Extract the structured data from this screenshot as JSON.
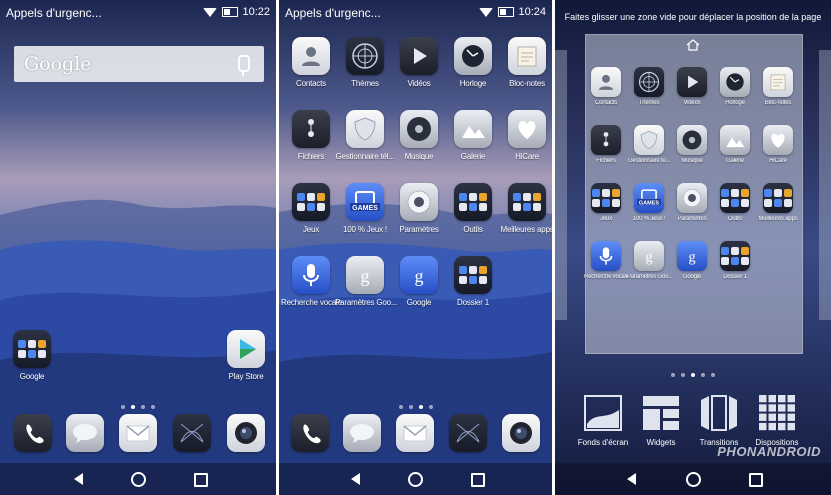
{
  "panels": [
    {
      "status": {
        "carrier": "Appels d'urgenc...",
        "time": "10:22"
      },
      "search": {
        "logo": "Google"
      },
      "apps": [
        {
          "label": "Google",
          "icon": "folder-icon"
        },
        {
          "label": "Play Store",
          "icon": "play-store-icon"
        }
      ],
      "page_indicator": {
        "count": 4,
        "active": 1
      },
      "dock": [
        "phone-icon",
        "messages-icon",
        "email-icon",
        "browser-icon",
        "camera-icon"
      ]
    },
    {
      "status": {
        "carrier": "Appels d'urgenc...",
        "time": "10:24"
      },
      "apps": [
        {
          "label": "Contacts",
          "icon": "contacts-icon"
        },
        {
          "label": "Thèmes",
          "icon": "themes-icon"
        },
        {
          "label": "Vidéos",
          "icon": "videos-icon"
        },
        {
          "label": "Horloge",
          "icon": "clock-icon"
        },
        {
          "label": "Bloc-notes",
          "icon": "notepad-icon"
        },
        {
          "label": "Fichiers",
          "icon": "files-icon"
        },
        {
          "label": "Gestionnaire tél...",
          "icon": "phone-manager-icon"
        },
        {
          "label": "Musique",
          "icon": "music-icon"
        },
        {
          "label": "Galerie",
          "icon": "gallery-icon"
        },
        {
          "label": "HiCare",
          "icon": "hicare-icon"
        },
        {
          "label": "Jeux",
          "icon": "folder-icon"
        },
        {
          "label": "100 % Jeux !",
          "icon": "games-icon"
        },
        {
          "label": "Paramètres",
          "icon": "settings-icon"
        },
        {
          "label": "Outils",
          "icon": "folder-icon"
        },
        {
          "label": "Meilleures apps",
          "icon": "folder-icon"
        },
        {
          "label": "Recherche vocale",
          "icon": "voice-search-icon"
        },
        {
          "label": "Paramètres Goo...",
          "icon": "google-settings-icon"
        },
        {
          "label": "Google",
          "icon": "google-icon"
        },
        {
          "label": "Dossier 1",
          "icon": "folder-icon"
        }
      ],
      "games_badge": "GAMES",
      "page_indicator": {
        "count": 4,
        "active": 2
      },
      "dock": [
        "phone-icon",
        "messages-icon",
        "email-icon",
        "browser-icon",
        "camera-icon"
      ]
    },
    {
      "hint": "Faites glisser une zone vide pour déplacer la position de la page",
      "apps": [
        {
          "label": "Contacts",
          "icon": "contacts-icon"
        },
        {
          "label": "Thèmes",
          "icon": "themes-icon"
        },
        {
          "label": "Vidéos",
          "icon": "videos-icon"
        },
        {
          "label": "Horloge",
          "icon": "clock-icon"
        },
        {
          "label": "Bloc-notes",
          "icon": "notepad-icon"
        },
        {
          "label": "Fichiers",
          "icon": "files-icon"
        },
        {
          "label": "Gestionnaire té...",
          "icon": "phone-manager-icon"
        },
        {
          "label": "Musique",
          "icon": "music-icon"
        },
        {
          "label": "Galerie",
          "icon": "gallery-icon"
        },
        {
          "label": "HiCare",
          "icon": "hicare-icon"
        },
        {
          "label": "Jeux",
          "icon": "folder-icon"
        },
        {
          "label": "100 % Jeux !",
          "icon": "games-icon"
        },
        {
          "label": "Paramètres",
          "icon": "settings-icon"
        },
        {
          "label": "Outils",
          "icon": "folder-icon"
        },
        {
          "label": "Meilleures apps",
          "icon": "folder-icon"
        },
        {
          "label": "Recherche vocale",
          "icon": "voice-search-icon"
        },
        {
          "label": "Paramètres Goo...",
          "icon": "google-settings-icon"
        },
        {
          "label": "Google",
          "icon": "google-icon"
        },
        {
          "label": "Dossier 1",
          "icon": "folder-icon"
        }
      ],
      "games_badge": "GAMES",
      "page_indicator": {
        "count": 5,
        "active": 2
      },
      "modes": [
        {
          "label": "Fonds d'écran",
          "icon": "wallpaper-icon"
        },
        {
          "label": "Widgets",
          "icon": "widgets-icon"
        },
        {
          "label": "Transitions",
          "icon": "transitions-icon"
        },
        {
          "label": "Dispositions",
          "icon": "layouts-icon"
        }
      ],
      "watermark": "PHONANDROID"
    }
  ],
  "colors": {
    "sky_top": "#1d2a52",
    "sky_mid": "#7f7aa6",
    "hills": "#2f4fa0",
    "accent_blue": "#3d6de0"
  }
}
